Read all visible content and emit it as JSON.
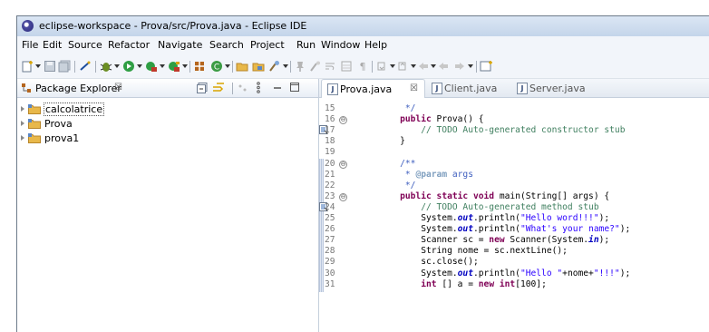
{
  "window": {
    "title": "eclipse-workspace - Prova/src/Prova.java - Eclipse IDE"
  },
  "menu": [
    "File",
    "Edit",
    "Source",
    "Refactor",
    "Navigate",
    "Search",
    "Project",
    "Run",
    "Window",
    "Help"
  ],
  "package_explorer": {
    "title": "Package Explorer",
    "close": "☒",
    "projects": [
      "calcolatrice",
      "Prova",
      "prova1"
    ],
    "selected": "calcolatrice"
  },
  "editor": {
    "tabs": [
      {
        "label": "Prova.java",
        "active": true,
        "close": "☒"
      },
      {
        "label": "Client.java",
        "active": false
      },
      {
        "label": "Server.java",
        "active": false
      }
    ],
    "line_numbers": [
      "15",
      "16",
      "17",
      "18",
      "19",
      "20",
      "21",
      "22",
      "23",
      "24",
      "25",
      "26",
      "27",
      "28",
      "29",
      "30",
      "31"
    ],
    "fold_glyph": "⊖",
    "code_lines": [
      "     */",
      "    public Prova() {",
      "        // TODO Auto-generated constructor stub",
      "    }",
      "",
      "    /**",
      "     * @param args",
      "     */",
      "    public static void main(String[] args) {",
      "        // TODO Auto-generated method stub",
      "        System.out.println(\"Hello word!!!\");",
      "        System.out.println(\"What's your name?\");",
      "        Scanner sc = new Scanner(System.in);",
      "        String nome = sc.nextLine();",
      "        sc.close();",
      "        System.out.println(\"Hello \"+nome+\"!!!\");",
      "        int [] a = new int[100];"
    ]
  },
  "colors": {
    "keyword": "#7f0055",
    "comment": "#3f7f5f",
    "javadoc": "#3f5fbf",
    "string": "#2a00ff",
    "field": "#0000c0"
  }
}
